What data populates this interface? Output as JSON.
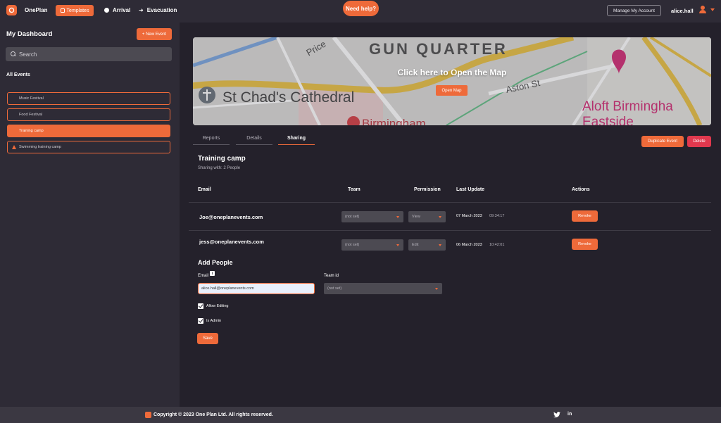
{
  "topbar": {
    "brand": "OnePlan",
    "nav": {
      "templates": "Templates",
      "arrival": "Arrival",
      "evacuation": "Evacuation"
    },
    "help": "Need help?",
    "account": "Manage My Account",
    "username": "alice.hall"
  },
  "sidebar": {
    "title": "My Dashboard",
    "new_event": "+ New Event",
    "search_placeholder": "Search",
    "all_events": "All Events",
    "events": [
      {
        "label": "Music Festival",
        "active": false,
        "warning": false
      },
      {
        "label": "Food Festival",
        "active": false,
        "warning": false
      },
      {
        "label": "Training camp",
        "active": true,
        "warning": false
      },
      {
        "label": "Swimming training camp",
        "active": false,
        "warning": true
      }
    ]
  },
  "map": {
    "labels": [
      "GUN QUARTER",
      "St Chad's Cathedral",
      "Aston St",
      "Price",
      "Aloft Birmingha",
      "Eastside",
      "Birmingham"
    ],
    "cta": "Click here to Open the Map",
    "open_map": "Open Map"
  },
  "tabs": [
    {
      "label": "Reports",
      "active": false
    },
    {
      "label": "Details",
      "active": false
    },
    {
      "label": "Sharing",
      "active": true
    }
  ],
  "actions": {
    "duplicate": "Duplicate Event",
    "delete": "Delete"
  },
  "event": {
    "title": "Training camp",
    "sharing_with": "Sharing with: 2 People"
  },
  "table": {
    "headers": {
      "email": "Email",
      "team": "Team",
      "permission": "Permission",
      "last_update": "Last Update",
      "actions": "Actions"
    },
    "rows": [
      {
        "email": "Joe@oneplanevents.com",
        "team": "(not set)",
        "permission": "View",
        "date": "07 March 2023",
        "time": "09:34:17",
        "action": "Revoke"
      },
      {
        "email": "jess@oneplanevents.com",
        "team": "(not set)",
        "permission": "Edit",
        "date": "06 March 2023",
        "time": "10:42:01",
        "action": "Revoke"
      }
    ]
  },
  "add_people": {
    "title": "Add People",
    "email_label": "Email",
    "email_value": "alice.hall@oneplanevents.com",
    "team_label": "Team id",
    "team_value": "(not set)",
    "allow_editing": "Allow Editing",
    "allow_editing_checked": true,
    "is_admin": "Is Admin",
    "is_admin_checked": true,
    "save": "Save"
  },
  "footer": {
    "copyright": "Copyright © 2023 One Plan Ltd. All rights reserved."
  },
  "colors": {
    "accent": "#ee6a3a",
    "danger": "#e0384e",
    "background": "#24212b",
    "panel": "#2e2b36"
  }
}
